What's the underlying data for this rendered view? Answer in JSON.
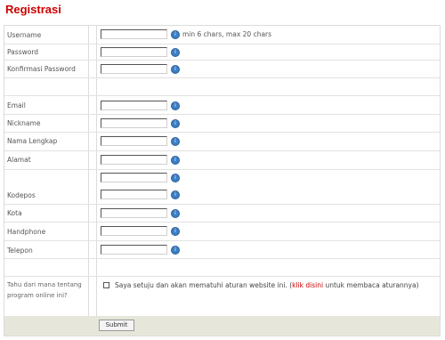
{
  "page": {
    "title": "Registrasi"
  },
  "fields": {
    "username": {
      "label": "Username",
      "hint": "min 6 chars, max 20 chars"
    },
    "password": {
      "label": "Password"
    },
    "confirm_password": {
      "label": "Konfirmasi Password"
    },
    "email": {
      "label": "Email"
    },
    "nickname": {
      "label": "Nickname"
    },
    "full_name": {
      "label": "Nama Lengkap"
    },
    "address": {
      "label": "Alamat"
    },
    "postal_code": {
      "label": "Kodepos"
    },
    "city": {
      "label": "Kota"
    },
    "handphone": {
      "label": "Handphone"
    },
    "phone": {
      "label": "Telepon"
    }
  },
  "source": {
    "label": "Tahu dari mana tentang program online ini?"
  },
  "agreement": {
    "text_before": "Saya setuju dan akan mematuhi aturan website ini. (",
    "link": "klik disini",
    "text_after": " untuk membaca aturannya)"
  },
  "required_icon": "info-icon",
  "submit_label": "Submit",
  "colors": {
    "title": "#cc0000",
    "footer_bg": "#e6e6da",
    "required_icon": "#3b7fc4"
  }
}
